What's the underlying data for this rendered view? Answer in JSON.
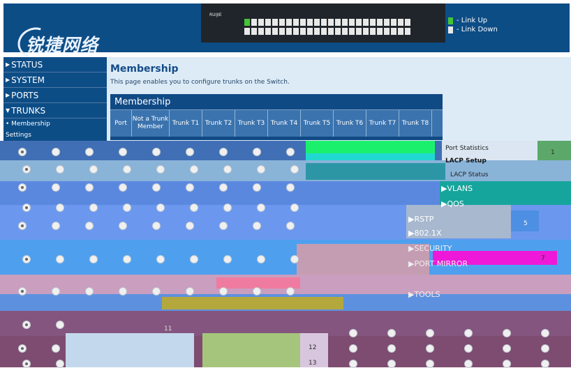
{
  "brand": {
    "logo_text": "锐捷网络",
    "device_text": "RUIJIE"
  },
  "legend": {
    "link_up": "- Link Up",
    "link_down": "- Link Down",
    "up_color": "#45c435",
    "down_color": "#e8e8e8"
  },
  "sidebar": {
    "items": [
      {
        "label": "STATUS",
        "arrow": "▶"
      },
      {
        "label": "SYSTEM",
        "arrow": "▶"
      },
      {
        "label": "PORTS",
        "arrow": "▶"
      },
      {
        "label": "TRUNKS",
        "arrow": "▼"
      }
    ],
    "subitems": [
      {
        "label": "• Membership"
      },
      {
        "label": "Settings"
      }
    ]
  },
  "page": {
    "title": "Membership",
    "description": "This page enables you to configure trunks on the Switch.",
    "table_title": "Membership"
  },
  "table": {
    "headers": [
      {
        "label": "Port"
      },
      {
        "label": "Not a Trunk Member"
      },
      {
        "label": "Trunk T1"
      },
      {
        "label": "Trunk T2"
      },
      {
        "label": "Trunk T3"
      },
      {
        "label": "Trunk T4"
      },
      {
        "label": "Trunk T5"
      },
      {
        "label": "Trunk T6"
      },
      {
        "label": "Trunk T7"
      },
      {
        "label": "Trunk T8"
      }
    ]
  },
  "ghost": {
    "stats": "Port Statistics",
    "lacp_setup": "LACP Setup",
    "lacp_status": "LACP Status",
    "vlans": "▶VLANS",
    "qos": "▶QOS",
    "rstp": "▶RSTP",
    "dot1x": "▶802.1X",
    "security": "▶SECURITY",
    "portmirror": "▶PORT MIRROR",
    "tools": "▶TOOLS",
    "row_numbers": [
      "1",
      "5",
      "7",
      "11",
      "12",
      "13"
    ]
  }
}
